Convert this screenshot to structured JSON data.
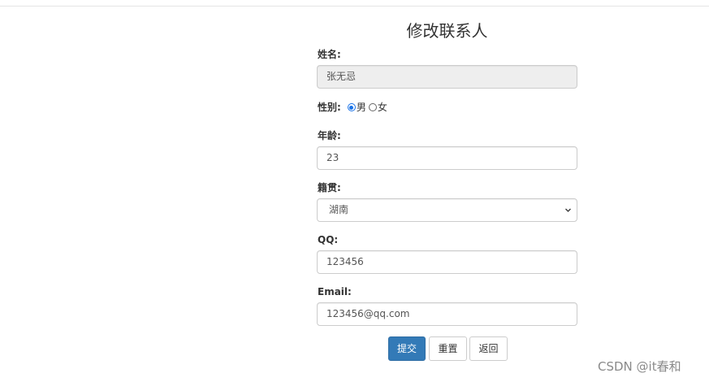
{
  "page": {
    "title": "修改联系人"
  },
  "form": {
    "name": {
      "label": "姓名:",
      "value": "张无忌"
    },
    "gender": {
      "label": "性别:",
      "options": [
        "男",
        "女"
      ],
      "selected": "男"
    },
    "age": {
      "label": "年龄:",
      "value": "23"
    },
    "hometown": {
      "label": "籍贯:",
      "selected": "湖南"
    },
    "qq": {
      "label": "QQ:",
      "value": "123456"
    },
    "email": {
      "label": "Email:",
      "value": "123456@qq.com"
    }
  },
  "buttons": {
    "submit": "提交",
    "reset": "重置",
    "back": "返回"
  },
  "colors": {
    "primary": "#337ab7",
    "radio_selected": "#1a73e8",
    "readonly_bg": "#eeeeee"
  },
  "watermark": "CSDN @it春和"
}
